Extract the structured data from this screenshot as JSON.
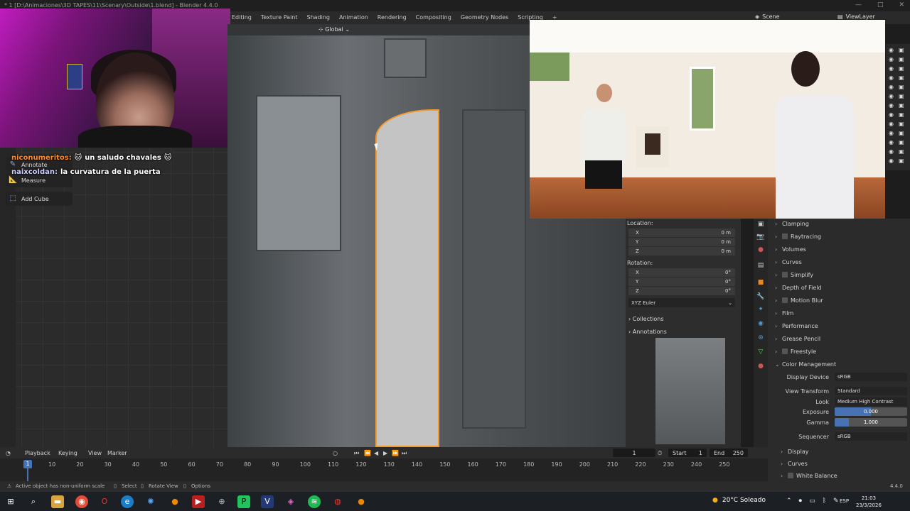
{
  "window": {
    "title": "* 1 [D:\\Animaciones\\3D TAPES\\11\\Scenary\\Outside\\1.blend] - Blender 4.4.0",
    "controls": [
      "—",
      "□",
      "✕"
    ]
  },
  "header": {
    "workspaces": [
      "Editing",
      "Texture Paint",
      "Shading",
      "Animation",
      "Rendering",
      "Compositing",
      "Geometry Nodes",
      "Scripting"
    ],
    "add_workspace": "+",
    "scene_label": "Scene",
    "view_layer_label": "ViewLayer"
  },
  "viewport": {
    "orientation": "Global"
  },
  "tools": [
    {
      "label": "Annotate",
      "icon": "pencil-icon"
    },
    {
      "label": "Measure",
      "icon": "ruler-icon"
    },
    {
      "label": "Add Cube",
      "icon": "cube-icon"
    }
  ],
  "chat": [
    {
      "user": "niconumeritos:",
      "emote_left": "🐱",
      "message": "un saludo chavales",
      "emote_right": "🐱"
    },
    {
      "user": "naixcoldan:",
      "message": "la curvatura de la puerta"
    }
  ],
  "transform": {
    "location_label": "Location:",
    "location": [
      {
        "axis": "X",
        "value": "0 m"
      },
      {
        "axis": "Y",
        "value": "0 m"
      },
      {
        "axis": "Z",
        "value": "0 m"
      }
    ],
    "rotation_label": "Rotation:",
    "rotation": [
      {
        "axis": "X",
        "value": "0°"
      },
      {
        "axis": "Y",
        "value": "0°"
      },
      {
        "axis": "Z",
        "value": "0°"
      }
    ],
    "rotation_mode": "XYZ Euler",
    "collections": "Collections",
    "annotations": "Annotations"
  },
  "render_props": {
    "sections": [
      {
        "label": "Clamping",
        "checkbox": false
      },
      {
        "label": "Raytracing",
        "checkbox": true
      },
      {
        "label": "Volumes",
        "checkbox": false
      },
      {
        "label": "Curves",
        "checkbox": false
      },
      {
        "label": "Simplify",
        "checkbox": true
      },
      {
        "label": "Depth of Field",
        "checkbox": false
      },
      {
        "label": "Motion Blur",
        "checkbox": true
      },
      {
        "label": "Film",
        "checkbox": false
      },
      {
        "label": "Performance",
        "checkbox": false
      },
      {
        "label": "Grease Pencil",
        "checkbox": false
      },
      {
        "label": "Freestyle",
        "checkbox": true
      }
    ],
    "color_management": "Color Management",
    "display_device_label": "Display Device",
    "display_device": "sRGB",
    "view_transform_label": "View Transform",
    "view_transform": "Standard",
    "look_label": "Look",
    "look": "Medium High Contrast",
    "exposure_label": "Exposure",
    "exposure": "0.000",
    "exposure_fill": 0.5,
    "gamma_label": "Gamma",
    "gamma": "1.000",
    "gamma_fill": 0.2,
    "sequencer_label": "Sequencer",
    "sequencer": "sRGB",
    "sub_sections": [
      "Display",
      "Curves",
      "White Balance"
    ]
  },
  "timeline": {
    "menus": [
      "Playback",
      "Keying",
      "View",
      "Marker"
    ],
    "current_frame": "1",
    "start_label": "Start",
    "start": "1",
    "end_label": "End",
    "end": "250",
    "ticks": [
      "10",
      "20",
      "30",
      "40",
      "50",
      "60",
      "70",
      "80",
      "90",
      "100",
      "110",
      "120",
      "130",
      "140",
      "150",
      "160",
      "170",
      "180",
      "190",
      "200",
      "210",
      "220",
      "230",
      "240",
      "250"
    ],
    "playhead": "1"
  },
  "status": {
    "message": "Active object has non-uniform scale",
    "select": "Select",
    "rotate_view": "Rotate View",
    "options": "Options",
    "version": "4.4.0"
  },
  "taskbar": {
    "weather": "20°C  Soleado",
    "lang": "ESP",
    "time": "21:03",
    "date": "23/3/2026"
  },
  "colors": {
    "accent": "#4772b3",
    "selection_outline": "#f39a2a"
  }
}
